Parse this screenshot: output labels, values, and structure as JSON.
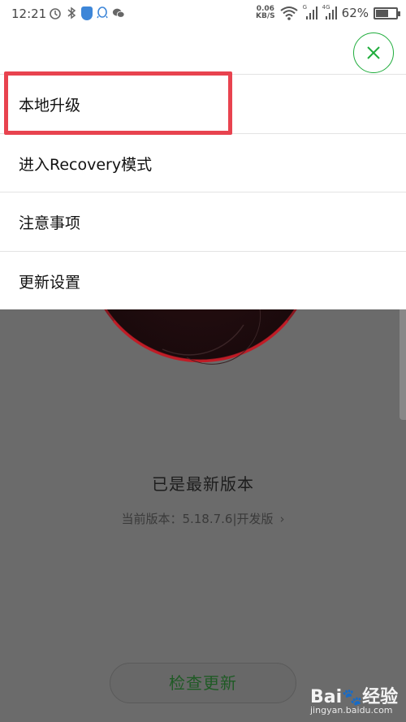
{
  "status_bar": {
    "time": "12:21",
    "net_speed_value": "0.06",
    "net_speed_unit": "KB/S",
    "signal_label_1": "G",
    "signal_label_2": "4G",
    "battery": "62%",
    "battery_level": 0.62,
    "icons": [
      "alarm-icon",
      "bluetooth-icon",
      "shield-icon",
      "qq-icon",
      "wechat-icon",
      "wifi-icon",
      "signal-icon",
      "battery-icon"
    ]
  },
  "menu": {
    "close_icon": "close-icon",
    "items": [
      {
        "label": "本地升级"
      },
      {
        "label": "进入Recovery模式"
      },
      {
        "label": "注意事项"
      },
      {
        "label": "更新设置"
      }
    ]
  },
  "background": {
    "status_title": "已是最新版本",
    "version_label": "当前版本：5.18.7.6|开发版",
    "check_button_label": "检查更新"
  },
  "watermark": {
    "url": "jingyan.baidu.com",
    "logo_text": "Bai",
    "logo_suffix": "经验"
  },
  "colors": {
    "accent_green": "#1fad3c",
    "highlight_red": "#e8434f",
    "dim_background": "#6b6b6b"
  }
}
